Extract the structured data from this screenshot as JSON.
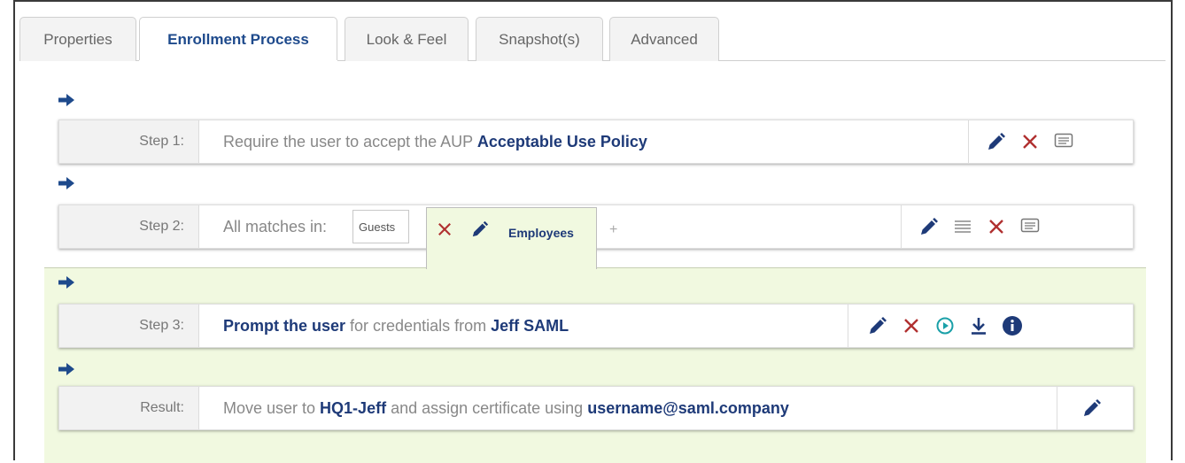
{
  "tabs": [
    {
      "label": "Properties",
      "active": false
    },
    {
      "label": "Enrollment Process",
      "active": true
    },
    {
      "label": "Look & Feel",
      "active": false
    },
    {
      "label": "Snapshot(s)",
      "active": false
    },
    {
      "label": "Advanced",
      "active": false
    }
  ],
  "colors": {
    "accent": "#1e4a8c",
    "delete": "#b03030",
    "play": "#1aa0a8",
    "green_bg": "#f1f9e0"
  },
  "steps": {
    "step1": {
      "label": "Step 1:",
      "text_prefix": "Require the user to accept the AUP ",
      "text_bold": "Acceptable Use Policy",
      "icons": [
        "edit-icon",
        "delete-icon",
        "comment-icon"
      ]
    },
    "step2": {
      "label": "Step 2:",
      "text": "All matches in:",
      "groups": [
        {
          "label": "Guests"
        },
        {
          "label": "Employees",
          "active": true
        }
      ],
      "add_label": "+",
      "icons": [
        "edit-icon",
        "list-icon",
        "delete-icon",
        "comment-icon"
      ]
    },
    "step3": {
      "label": "Step 3:",
      "text_bold1": "Prompt the user",
      "text_mid": " for credentials from ",
      "text_bold2": "Jeff SAML",
      "icons": [
        "edit-icon",
        "delete-icon",
        "play-icon",
        "download-icon",
        "info-icon"
      ]
    },
    "result": {
      "label": "Result:",
      "text_pre": "Move user to ",
      "text_bold1": "HQ1-Jeff",
      "text_mid": " and assign certificate using ",
      "text_bold2": "username@saml.company",
      "icons": [
        "edit-icon"
      ]
    }
  }
}
